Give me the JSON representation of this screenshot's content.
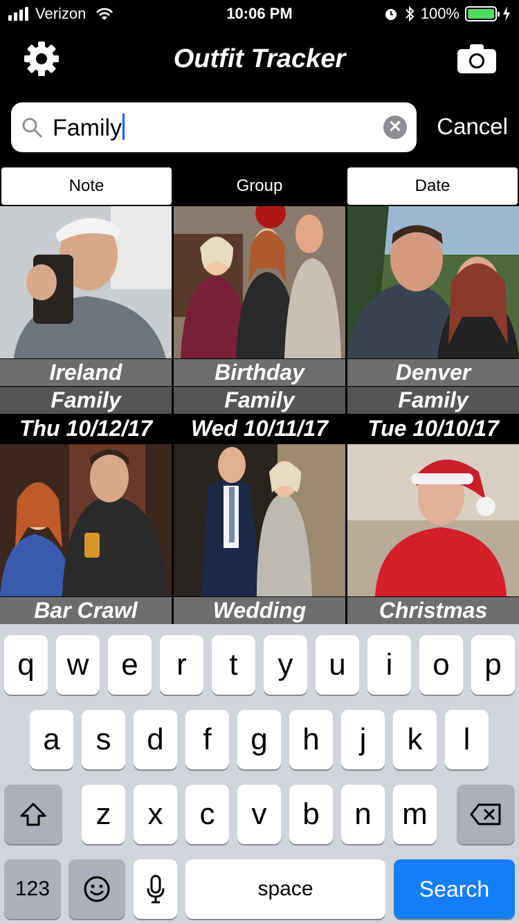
{
  "status": {
    "carrier": "Verizon",
    "time": "10:06 PM",
    "battery": "100%"
  },
  "nav": {
    "title": "Outfit Tracker"
  },
  "search": {
    "value": "Family",
    "cancel_label": "Cancel"
  },
  "segments": [
    "Note",
    "Group",
    "Date"
  ],
  "items": [
    {
      "note": "Ireland",
      "group": "Family",
      "date": "Thu  10/12/17"
    },
    {
      "note": "Birthday",
      "group": "Family",
      "date": "Wed  10/11/17"
    },
    {
      "note": "Denver",
      "group": "Family",
      "date": "Tue  10/10/17"
    },
    {
      "note": "Bar Crawl"
    },
    {
      "note": "Wedding"
    },
    {
      "note": "Christmas"
    }
  ],
  "keyboard": {
    "row1": [
      "q",
      "w",
      "e",
      "r",
      "t",
      "y",
      "u",
      "i",
      "o",
      "p"
    ],
    "row2": [
      "a",
      "s",
      "d",
      "f",
      "g",
      "h",
      "j",
      "k",
      "l"
    ],
    "row3": [
      "z",
      "x",
      "c",
      "v",
      "b",
      "n",
      "m"
    ],
    "numbers_label": "123",
    "space_label": "space",
    "search_label": "Search"
  },
  "colors": {
    "accent": "#147efb",
    "battery": "#4cd964"
  }
}
